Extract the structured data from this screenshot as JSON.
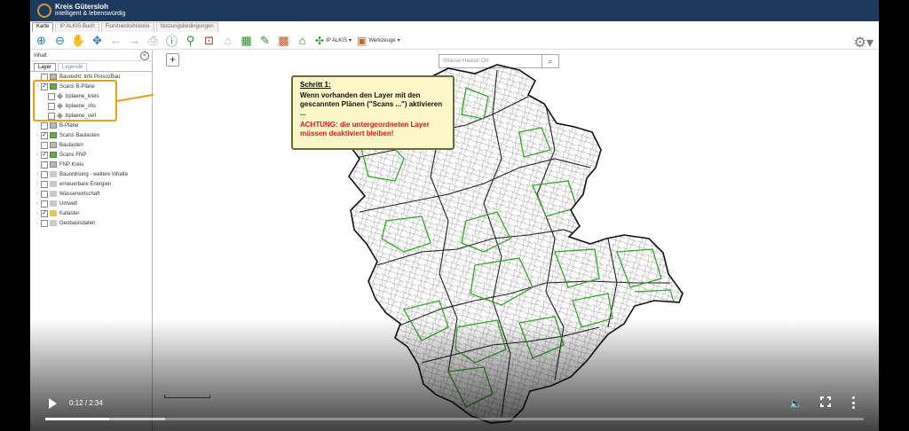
{
  "app": {
    "logo_name": "Kreis Gütersloh",
    "logo_sub": "intelligent & lebenswürdig"
  },
  "tabs": [
    "Karte",
    "IP ALKIS Buch",
    "Flurstueckshistorie",
    "Nutzungsbedingungen"
  ],
  "toolbar": {
    "ipalkis_label": "IP ALKIS",
    "werkzeuge_label": "Werkzeuge"
  },
  "panel": {
    "title": "Inhalt",
    "tab_layer": "Layer",
    "tab_legende": "Legende",
    "collapse_glyph": "<"
  },
  "layers": [
    {
      "label": "Baurecht: Info ProsozBau",
      "checked": false,
      "icon": "gray",
      "indent": 0,
      "chevron": false
    },
    {
      "label": "Scans B-Pläne",
      "checked": true,
      "icon": "green",
      "indent": 0,
      "chevron": true
    },
    {
      "label": "bplaene_kreis",
      "checked": false,
      "icon": "diamond",
      "indent": 1,
      "chevron": false
    },
    {
      "label": "bplaene_shs",
      "checked": false,
      "icon": "diamond",
      "indent": 1,
      "chevron": false
    },
    {
      "label": "bplaene_verl",
      "checked": false,
      "icon": "diamond",
      "indent": 1,
      "chevron": false
    },
    {
      "label": "B-Pläne",
      "checked": false,
      "icon": "gray",
      "indent": 0,
      "chevron": false
    },
    {
      "label": "Scans Baulasten",
      "checked": true,
      "icon": "green",
      "indent": 0,
      "chevron": true
    },
    {
      "label": "Baulasten",
      "checked": false,
      "icon": "gray",
      "indent": 0,
      "chevron": false
    },
    {
      "label": "Scans FNP",
      "checked": true,
      "icon": "green",
      "indent": 0,
      "chevron": true
    },
    {
      "label": "FNP Kreis",
      "checked": false,
      "icon": "gray",
      "indent": 0,
      "chevron": false
    },
    {
      "label": "Bauordnung - weitere Inhalte",
      "checked": false,
      "icon": "folder",
      "indent": 0,
      "chevron": true
    },
    {
      "label": "erneuerbare Energien",
      "checked": false,
      "icon": "folder",
      "indent": 0,
      "chevron": true
    },
    {
      "label": "Wasserwirtschaft",
      "checked": false,
      "icon": "folder",
      "indent": 0,
      "chevron": true
    },
    {
      "label": "Umwelt",
      "checked": false,
      "icon": "folder",
      "indent": 0,
      "chevron": true
    },
    {
      "label": "Kataster",
      "checked": true,
      "icon": "folderyel",
      "indent": 0,
      "chevron": true
    },
    {
      "label": "Geobasisdaten",
      "checked": false,
      "icon": "folder",
      "indent": 0,
      "chevron": true
    }
  ],
  "map": {
    "zoom_in": "+",
    "search_placeholder": "Strasse  Hausnr  Ort"
  },
  "callout": {
    "heading": "Schritt 1:",
    "body": "Wenn vorhanden den Layer mit den gescannten Plänen (\"Scans ...\") aktivieren ...",
    "warning": "ACHTUNG: die untergeordneten Layer müssen deaktiviert bleiben!"
  },
  "video": {
    "time": "0:12 / 2:34",
    "progress": 0.078,
    "buffered": 0.146
  },
  "colors": {
    "accent_orange": "#e8a21a",
    "warning_red": "#d41b1b",
    "boundary_green": "#3aa52e"
  }
}
